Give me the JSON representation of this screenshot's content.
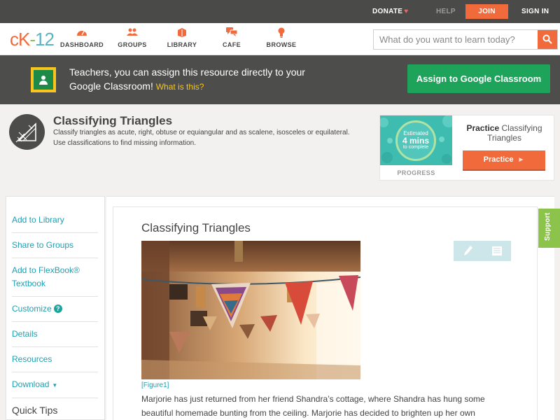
{
  "topbar": {
    "donate": "DONATE",
    "help": "HELP",
    "join": "JOIN",
    "signin": "SIGN IN"
  },
  "nav": {
    "logo": {
      "ck": "cK",
      "dash": "-",
      "num": "12"
    },
    "items": [
      {
        "label": "DASHBOARD",
        "icon": "dashboard-icon"
      },
      {
        "label": "GROUPS",
        "icon": "groups-icon"
      },
      {
        "label": "LIBRARY",
        "icon": "library-icon"
      },
      {
        "label": "CAFE",
        "icon": "cafe-icon"
      },
      {
        "label": "BROWSE",
        "icon": "browse-icon"
      }
    ],
    "search_placeholder": "What do you want to learn today?"
  },
  "banner": {
    "text": "Teachers, you can assign this resource directly to your Google Classroom!",
    "link": "What is this?",
    "button": "Assign to Google Classroom"
  },
  "concept": {
    "title": "Classifying Triangles",
    "description": "Classify triangles as acute, right, obtuse or equiangular and as scalene, isosceles or equilateral. Use classifications to find missing information.",
    "progress": {
      "estimated": "Estimated",
      "mins": "4 mins",
      "to_complete": "to complete",
      "label": "PROGRESS"
    },
    "practice_title_bold": "Practice",
    "practice_title_rest": "Classifying Triangles",
    "practice_button": "Practice"
  },
  "sidebar": {
    "items": [
      {
        "label": "Add to Library"
      },
      {
        "label": "Share to Groups"
      },
      {
        "label": "Add to FlexBook® Textbook"
      },
      {
        "label": "Customize"
      },
      {
        "label": "Details"
      },
      {
        "label": "Resources"
      },
      {
        "label": "Download"
      }
    ],
    "quick_tips": "Quick Tips"
  },
  "article": {
    "title": "Classifying Triangles",
    "figure_caption": "[Figure1]",
    "paragraph": "Marjorie has just returned from her friend Shandra’s cottage, where Shandra has hung some beautiful homemade bunting from the ceiling. Marjorie has decided to brighten up her own"
  },
  "support": "Support",
  "colors": {
    "brand_orange": "#f06a3c",
    "brand_green": "#8cc04b",
    "brand_teal": "#5bb4c2",
    "link": "#1f9fb0",
    "google_green": "#1ea35b"
  }
}
